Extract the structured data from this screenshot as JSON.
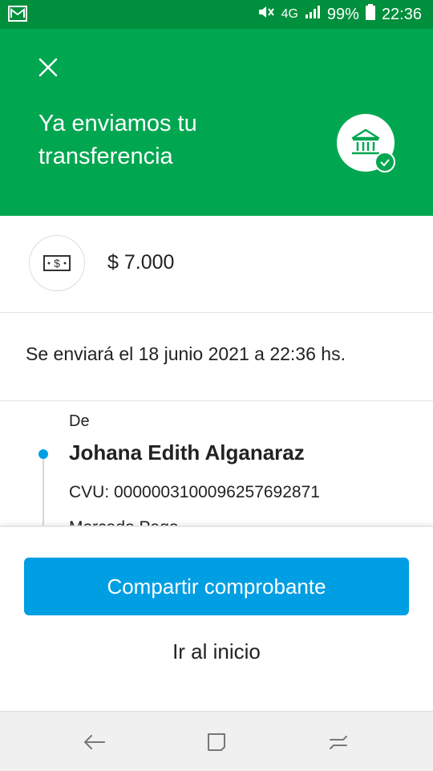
{
  "status_bar": {
    "network": "4G",
    "battery": "99%",
    "time": "22:36",
    "icons": [
      "gmail-icon",
      "mute-icon",
      "network-icon",
      "signal-icon",
      "battery-icon"
    ]
  },
  "header": {
    "title": "Ya enviamos tu transferencia",
    "icons": [
      "close-icon",
      "bank-icon",
      "check-icon"
    ],
    "color": "#00a650"
  },
  "amount": {
    "value": "$ 7.000",
    "icon": "money-bill-icon"
  },
  "schedule": {
    "text": "Se enviará el 18 junio 2021 a 22:36 hs."
  },
  "from": {
    "label": "De",
    "name": "Johana Edith Alganaraz",
    "cvu": "CVU: 0000003100096257692871",
    "extra": "Mercado Pago"
  },
  "actions": {
    "share_label": "Compartir comprobante",
    "home_label": "Ir al inicio",
    "accent": "#009ee3"
  },
  "navbar": {
    "icons": [
      "back-icon",
      "home-square-icon",
      "recents-icon"
    ]
  }
}
